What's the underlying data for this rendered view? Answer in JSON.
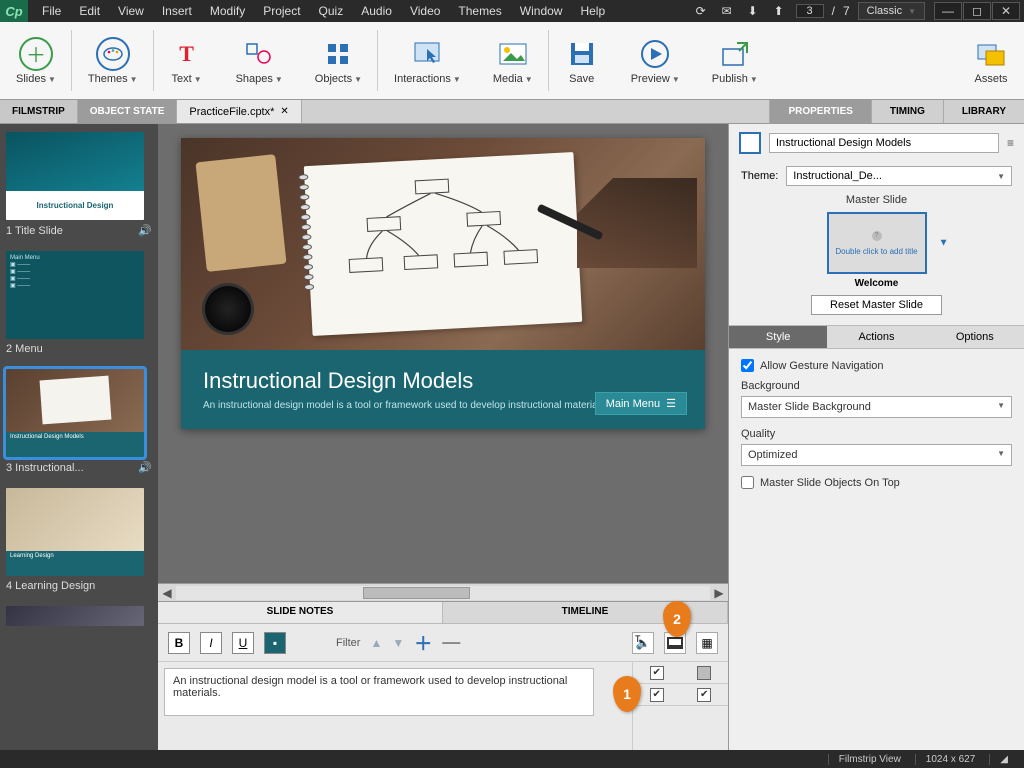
{
  "menubar": [
    "File",
    "Edit",
    "View",
    "Insert",
    "Modify",
    "Project",
    "Quiz",
    "Audio",
    "Video",
    "Themes",
    "Window",
    "Help"
  ],
  "page_current": "3",
  "page_total": "7",
  "workspace": "Classic",
  "ribbon": [
    {
      "label": "Slides",
      "caret": true
    },
    {
      "label": "Themes",
      "caret": true
    },
    {
      "label": "Text",
      "caret": true
    },
    {
      "label": "Shapes",
      "caret": true
    },
    {
      "label": "Objects",
      "caret": true
    },
    {
      "label": "Interactions",
      "caret": true
    },
    {
      "label": "Media",
      "caret": true
    },
    {
      "label": "Save",
      "caret": false
    },
    {
      "label": "Preview",
      "caret": true
    },
    {
      "label": "Publish",
      "caret": true
    },
    {
      "label": "Assets",
      "caret": false
    }
  ],
  "left_tabs": {
    "filmstrip": "FILMSTRIP",
    "state": "OBJECT STATE"
  },
  "file_tab": "PracticeFile.cptx*",
  "right_tabs": {
    "properties": "PROPERTIES",
    "timing": "TIMING",
    "library": "LIBRARY"
  },
  "thumbs": [
    {
      "label": "1 Title Slide",
      "audio": true
    },
    {
      "label": "2 Menu",
      "audio": false
    },
    {
      "label": "3 Instructional...",
      "audio": true,
      "selected": true
    },
    {
      "label": "4 Learning Design",
      "audio": false
    }
  ],
  "slide": {
    "title": "Instructional Design Models",
    "subtitle": "An instructional design model is a tool or framework used to develop instructional materials.",
    "menu_btn": "Main Menu"
  },
  "bottom": {
    "tab_notes": "SLIDE NOTES",
    "tab_timeline": "TIMELINE",
    "filter": "Filter",
    "note_text": "An instructional design model is a tool or framework used to develop instructional materials.",
    "callout1": "1",
    "callout2": "2"
  },
  "props": {
    "name": "Instructional Design Models",
    "theme_lbl": "Theme:",
    "theme_val": "Instructional_De...",
    "master_slide": "Master Slide",
    "master_hint": "Double click to add title",
    "welcome": "Welcome",
    "reset": "Reset Master Slide",
    "tabs": {
      "style": "Style",
      "actions": "Actions",
      "options": "Options"
    },
    "gesture": "Allow Gesture Navigation",
    "background": "Background",
    "background_val": "Master Slide Background",
    "quality": "Quality",
    "quality_val": "Optimized",
    "ontop": "Master Slide Objects On Top"
  },
  "status": {
    "view": "Filmstrip View",
    "dims": "1024 x 627"
  }
}
